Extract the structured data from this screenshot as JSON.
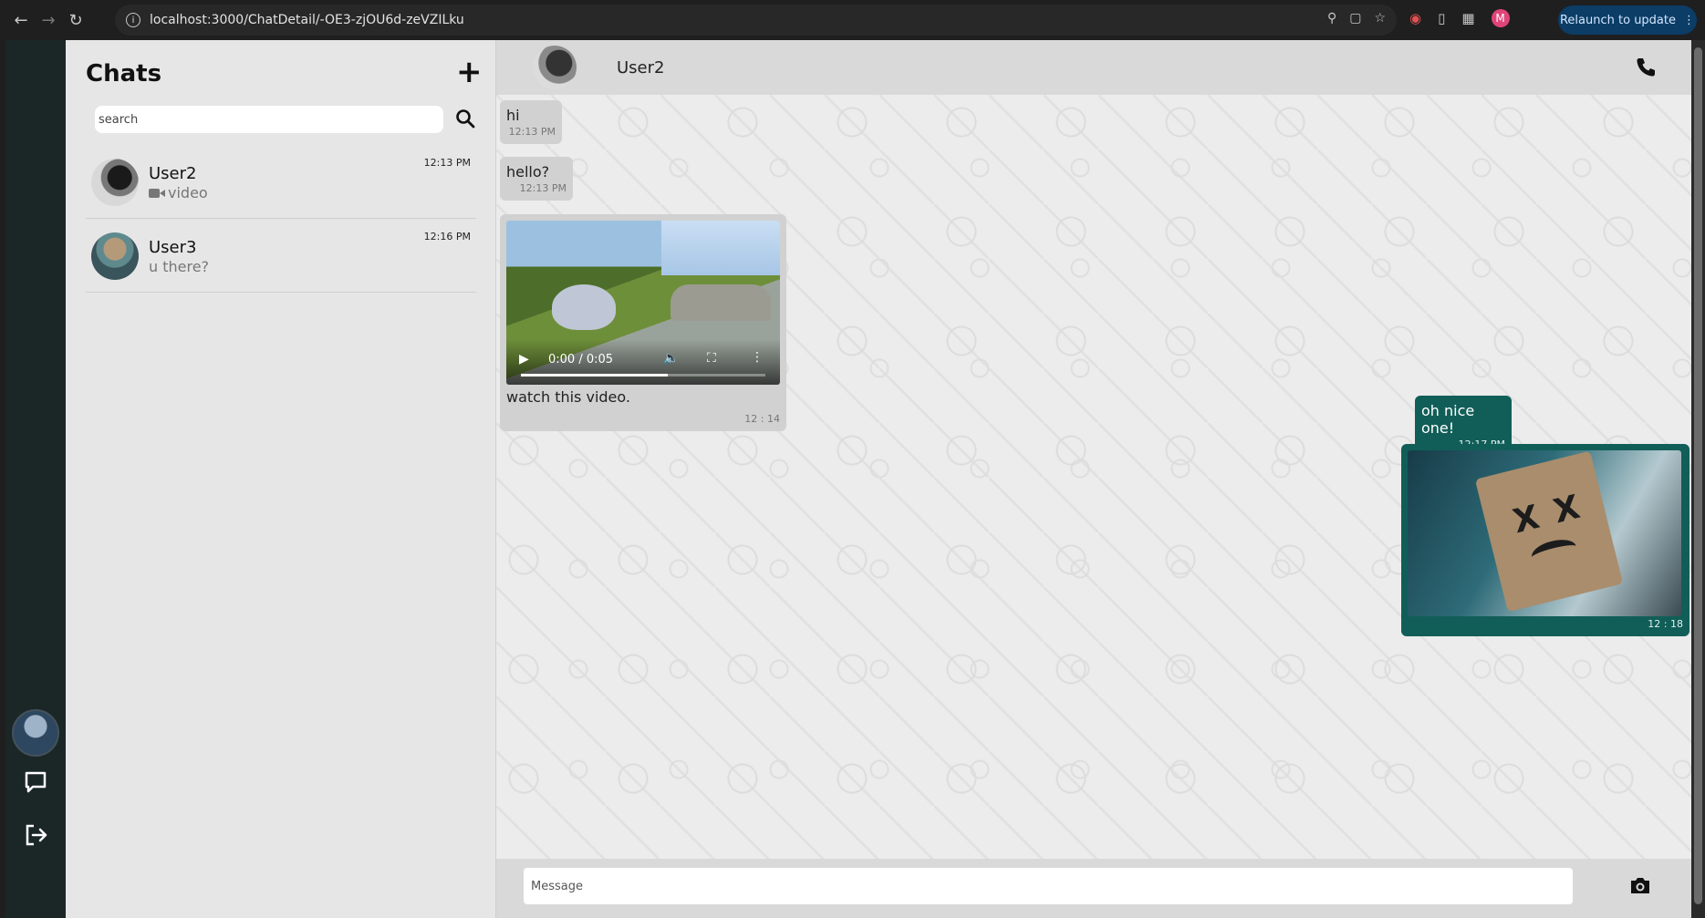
{
  "browser": {
    "url": "localhost:3000/ChatDetail/-OE3-zjOU6d-zeVZILku",
    "relaunch_label": "Relaunch to update",
    "profile_initial": "M"
  },
  "sidebar": {
    "title": "Chats",
    "add_icon": "plus-icon",
    "search_placeholder": "search",
    "chats": [
      {
        "name": "User2",
        "preview": "video",
        "preview_icon": "video-camera-icon",
        "time": "12:13 PM"
      },
      {
        "name": "User3",
        "preview": "u there?",
        "time": "12:16 PM"
      }
    ]
  },
  "rail": {
    "icons": [
      "user-avatar",
      "chat-bubble-icon",
      "logout-icon"
    ]
  },
  "conversation": {
    "contact_name": "User2",
    "messages": [
      {
        "direction": "in",
        "type": "text",
        "text": "hi",
        "time": "12:13 PM"
      },
      {
        "direction": "in",
        "type": "text",
        "text": "hello?",
        "time": "12:13 PM"
      },
      {
        "direction": "in",
        "type": "video",
        "video_time": "0:00 / 0:05",
        "caption": "watch this video.",
        "time": "12 : 14",
        "progress": 0.6
      },
      {
        "direction": "out",
        "type": "text",
        "text": "oh nice one!",
        "time": "12:17 PM"
      },
      {
        "direction": "out",
        "type": "image",
        "time": "12 : 18"
      }
    ]
  },
  "composer": {
    "placeholder": "Message",
    "camera_icon": "camera-icon"
  },
  "colors": {
    "rail_bg": "#1b2627",
    "sidebar_bg": "#e6e6e6",
    "incoming_bubble": "#d1d1d1",
    "outgoing_bubble": "#115e58"
  }
}
